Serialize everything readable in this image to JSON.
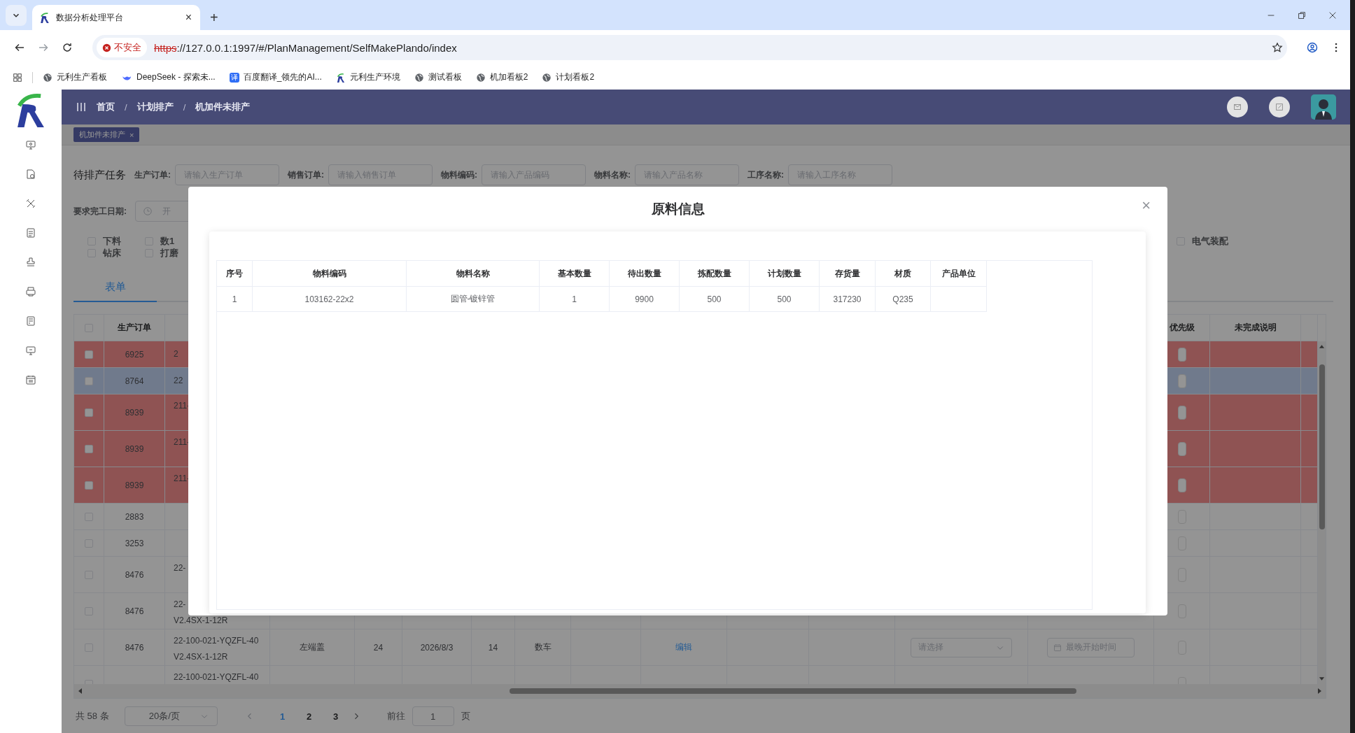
{
  "browser": {
    "tab": {
      "title": "数据分析处理平台",
      "close": "×"
    },
    "new_tab": "+",
    "security_label": "不安全",
    "url_scheme": "https",
    "url_rest": "://127.0.0.1:1997/#/PlanManagement/SelfMakePlando/index",
    "bookmarks": [
      {
        "label": "元利生产看板",
        "kind": "globe"
      },
      {
        "label": "DeepSeek - 探索未...",
        "kind": "whale"
      },
      {
        "label": "百度翻译_领先的AI...",
        "kind": "badge",
        "badge_text": "译"
      },
      {
        "label": "元利生产环境",
        "kind": "logo"
      },
      {
        "label": "测试看板",
        "kind": "globe"
      },
      {
        "label": "机加看板2",
        "kind": "globe"
      },
      {
        "label": "计划看板2",
        "kind": "globe"
      }
    ]
  },
  "header": {
    "breadcrumb": [
      {
        "label": "首页"
      },
      {
        "label": "计划排产"
      },
      {
        "label": "机加件未排产"
      }
    ],
    "separator": "/"
  },
  "tags": [
    {
      "label": "机加件未排产",
      "close": "×",
      "selected": true
    }
  ],
  "filters": {
    "title": "待排产任务",
    "fields": [
      {
        "label": "生产订单:",
        "placeholder": "请输入生产订单"
      },
      {
        "label": "销售订单:",
        "placeholder": "请输入销售订单"
      },
      {
        "label": "物料编码:",
        "placeholder": "请输入产品编码"
      },
      {
        "label": "物料名称:",
        "placeholder": "请输入产品名称"
      },
      {
        "label": "工序名称:",
        "placeholder": "请输入工序名称"
      }
    ],
    "date_field": {
      "label": "要求完工日期:",
      "placeholder": "开"
    }
  },
  "process_checks": [
    {
      "label": "下料",
      "checked": false
    },
    {
      "label": "钻床",
      "checked": false
    },
    {
      "label": "数1",
      "checked": false
    },
    {
      "label": "打磨",
      "checked": false
    },
    {
      "label": "电气装配",
      "checked": false
    }
  ],
  "view_tabs": [
    {
      "label": "表单",
      "selected": true
    }
  ],
  "table": {
    "headers": {
      "order": "生产订单",
      "priority": "优先级",
      "note": "未完成说明"
    },
    "header_checked": false,
    "rows": [
      {
        "order": "6925",
        "code": [
          "2"
        ],
        "flagged": true,
        "selected": false,
        "checked": false,
        "wrapped": false
      },
      {
        "order": "8764",
        "code": [
          "22"
        ],
        "flagged": false,
        "selected": true,
        "checked": false,
        "wrapped": false
      },
      {
        "order": "8939",
        "code": [
          "211-"
        ],
        "flagged": true,
        "selected": false,
        "checked": false,
        "wrapped": true
      },
      {
        "order": "8939",
        "code": [
          "211-"
        ],
        "flagged": true,
        "selected": false,
        "checked": false,
        "wrapped": true
      },
      {
        "order": "8939",
        "code": [
          "211-"
        ],
        "flagged": true,
        "selected": false,
        "checked": false,
        "wrapped": true
      },
      {
        "order": "2883",
        "flagged": false,
        "selected": false,
        "checked": false,
        "wrapped": false
      },
      {
        "order": "3253",
        "flagged": false,
        "selected": false,
        "checked": false,
        "wrapped": false
      },
      {
        "order": "8476",
        "code": [
          "22-"
        ],
        "flagged": false,
        "selected": false,
        "checked": false,
        "wrapped": true
      },
      {
        "order": "8476",
        "code": [
          "22-",
          "V2.4SX-1-12R"
        ],
        "flagged": false,
        "selected": false,
        "checked": false,
        "wrapped": true
      },
      {
        "order": "8476",
        "code": [
          "22-100-021-YQZFL-40",
          "V2.4SX-1-12R"
        ],
        "name": "左端盖",
        "qty": "24",
        "date": "2026/8/3",
        "count": "14",
        "process": "数车",
        "action": "编辑",
        "select": "请选择",
        "start_time": "最晚开始时间",
        "flagged": false,
        "selected": false,
        "checked": false,
        "wrapped": true
      },
      {
        "code": [
          "22-100-021-YQZFL-40"
        ],
        "flagged": false,
        "selected": false,
        "checked": false,
        "wrapped": true
      }
    ]
  },
  "pagination": {
    "total": "共 58 条",
    "page_size": "20条/页",
    "pages": [
      {
        "label": "1",
        "selected": true
      },
      {
        "label": "2",
        "selected": false
      },
      {
        "label": "3",
        "selected": false
      }
    ],
    "goto_label": "前往",
    "goto_value": "1",
    "goto_suffix": "页"
  },
  "modal": {
    "title": "原料信息",
    "close": "×",
    "columns": [
      "序号",
      "物料编码",
      "物料名称",
      "基本数量",
      "待出数量",
      "拣配数量",
      "计划数量",
      "存货量",
      "材质",
      "产品单位"
    ],
    "rows": [
      {
        "cells": [
          "1",
          "103162-22x2",
          "圆管-镀锌管",
          "1",
          "9900",
          "500",
          "500",
          "317230",
          "Q235"
        ]
      }
    ]
  }
}
